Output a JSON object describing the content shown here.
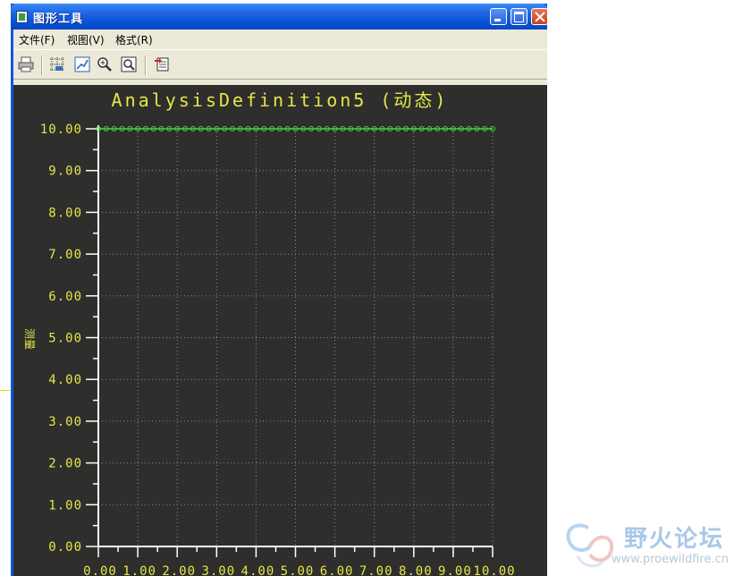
{
  "window": {
    "title": "图形工具"
  },
  "menu": [
    {
      "label": "文件(F)",
      "name": "menu-file"
    },
    {
      "label": "视图(V)",
      "name": "menu-view"
    },
    {
      "label": "格式(R)",
      "name": "menu-format"
    }
  ],
  "toolbar": {
    "tools": [
      "print-icon",
      "grid-icon",
      "edit-curve-icon",
      "zoom-in-icon",
      "zoom-fit-icon",
      "export-icon"
    ]
  },
  "colors": {
    "plot_background": "#2e2e2c",
    "axis_text": "#e6e64a",
    "series_line": "#45d645",
    "axis_line": "#ffffff",
    "grid": "#8a8a8a"
  },
  "chart_data": {
    "type": "line",
    "title": "AnalysisDefinition5 (动态)",
    "xlabel": "",
    "ylabel": "测量",
    "xlim": [
      0,
      10
    ],
    "ylim": [
      0,
      10
    ],
    "grid": true,
    "x_ticks": [
      "0.00",
      "1.00",
      "2.00",
      "3.00",
      "4.00",
      "5.00",
      "6.00",
      "7.00",
      "8.00",
      "9.00",
      "10.00"
    ],
    "y_ticks": [
      "0.00",
      "1.00",
      "2.00",
      "3.00",
      "4.00",
      "5.00",
      "6.00",
      "7.00",
      "8.00",
      "9.00",
      "10.00"
    ],
    "series": [
      {
        "x": [
          0,
          0.2,
          0.4,
          0.6,
          0.8,
          1,
          1.2,
          1.4,
          1.6,
          1.8,
          2,
          2.2,
          2.4,
          2.6,
          2.8,
          3,
          3.2,
          3.4,
          3.6,
          3.8,
          4,
          4.2,
          4.4,
          4.6,
          4.8,
          5,
          5.2,
          5.4,
          5.6,
          5.8,
          6,
          6.2,
          6.4,
          6.6,
          6.8,
          7,
          7.2,
          7.4,
          7.6,
          7.8,
          8,
          8.2,
          8.4,
          8.6,
          8.8,
          9,
          9.2,
          9.4,
          9.6,
          9.8,
          10
        ],
        "values": [
          10,
          10,
          10,
          10,
          10,
          10,
          10,
          10,
          10,
          10,
          10,
          10,
          10,
          10,
          10,
          10,
          10,
          10,
          10,
          10,
          10,
          10,
          10,
          10,
          10,
          10,
          10,
          10,
          10,
          10,
          10,
          10,
          10,
          10,
          10,
          10,
          10,
          10,
          10,
          10,
          10,
          10,
          10,
          10,
          10,
          10,
          10,
          10,
          10,
          10,
          10
        ]
      }
    ]
  },
  "watermark": {
    "brand": "野火论坛",
    "url": "www.proewildfire.cn"
  }
}
